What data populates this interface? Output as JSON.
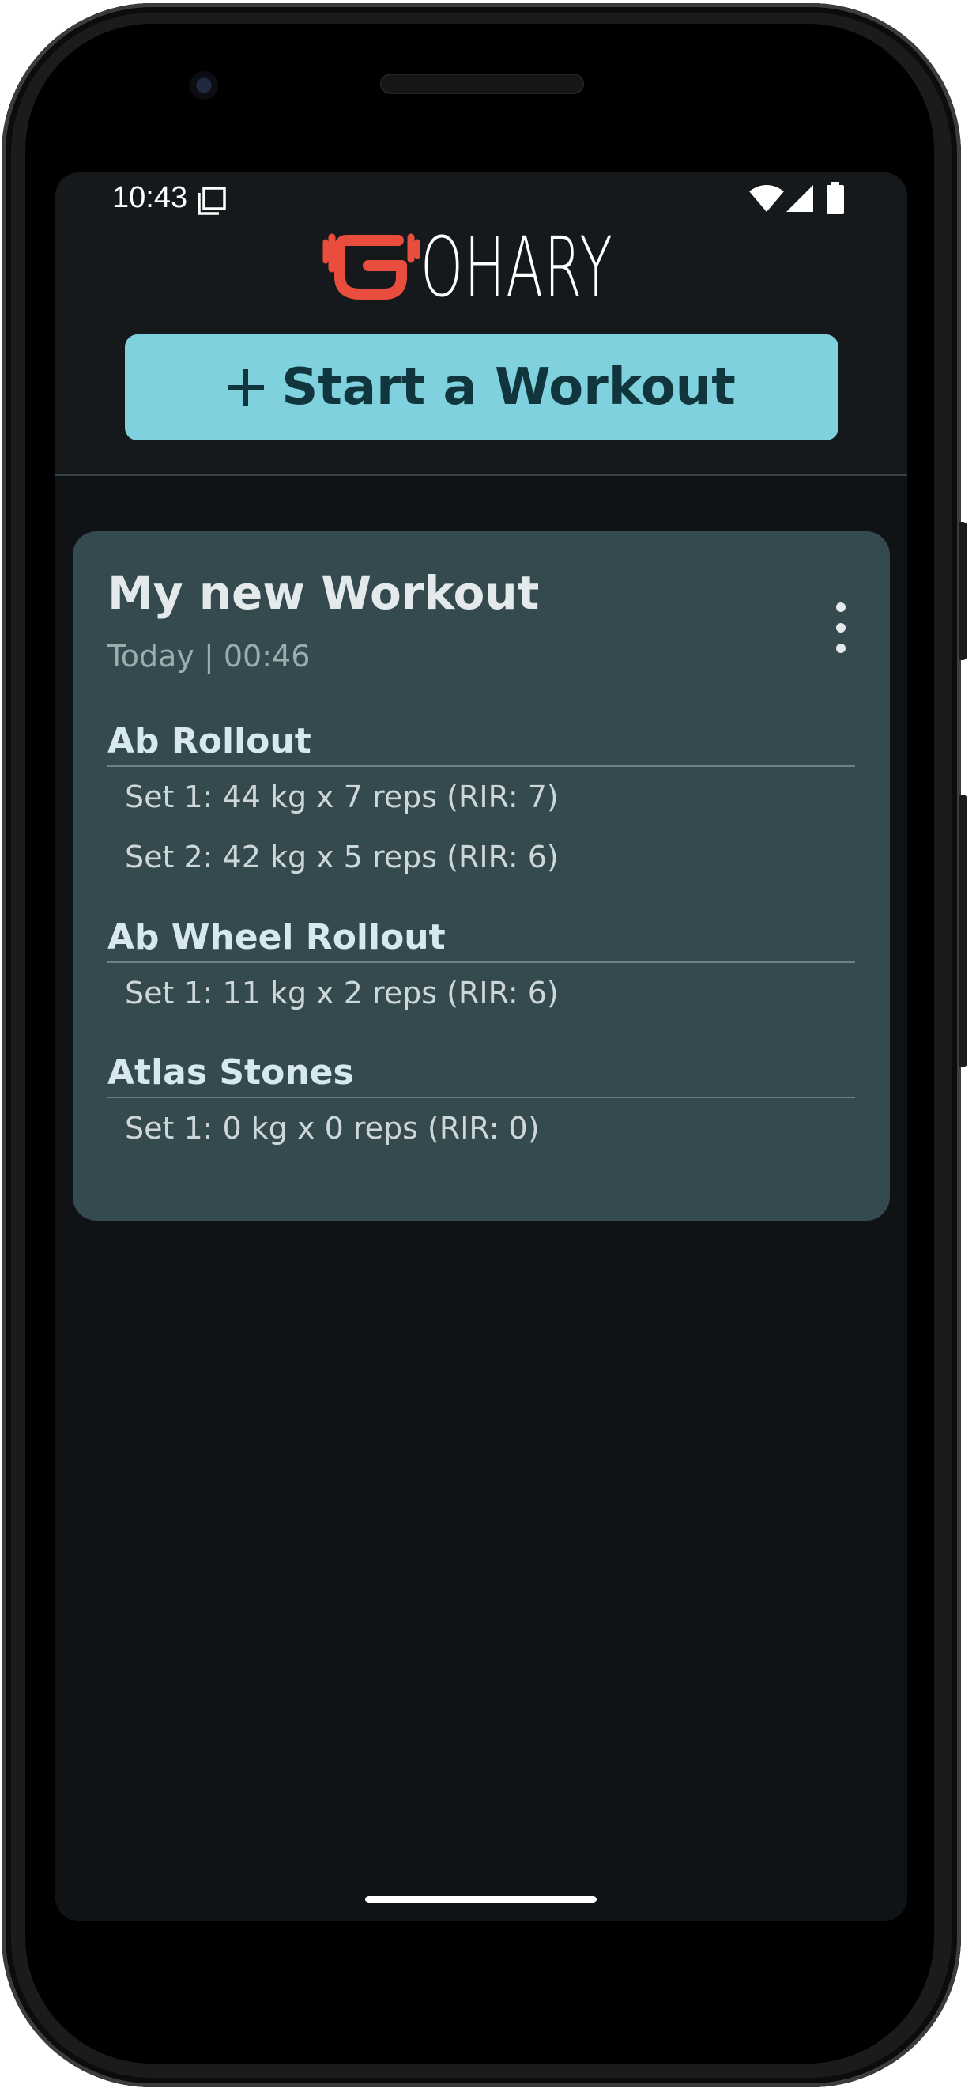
{
  "status_bar": {
    "time": "10:43",
    "icons": [
      "screen-record-icon",
      "wifi-icon",
      "signal-icon",
      "battery-icon"
    ]
  },
  "header": {
    "logo_text": "OHARY",
    "logo_color": "#e84d3d",
    "start_button_label": "Start a Workout",
    "start_button_color": "#7ed1dd"
  },
  "workout": {
    "title": "My new Workout",
    "meta": "Today | 00:46",
    "exercises": [
      {
        "name": "Ab Rollout",
        "sets": [
          "Set 1: 44 kg x 7 reps (RIR: 7)",
          "Set 2: 42 kg x 5 reps (RIR: 6)"
        ]
      },
      {
        "name": "Ab Wheel Rollout",
        "sets": [
          "Set 1: 11 kg x 2 reps (RIR: 6)"
        ]
      },
      {
        "name": "Atlas Stones",
        "sets": [
          "Set 1: 0 kg x 0 reps (RIR: 0)"
        ]
      }
    ]
  },
  "colors": {
    "screen_background": "#0f1315",
    "header_background": "#15191b",
    "card_background": "#354a4e"
  }
}
